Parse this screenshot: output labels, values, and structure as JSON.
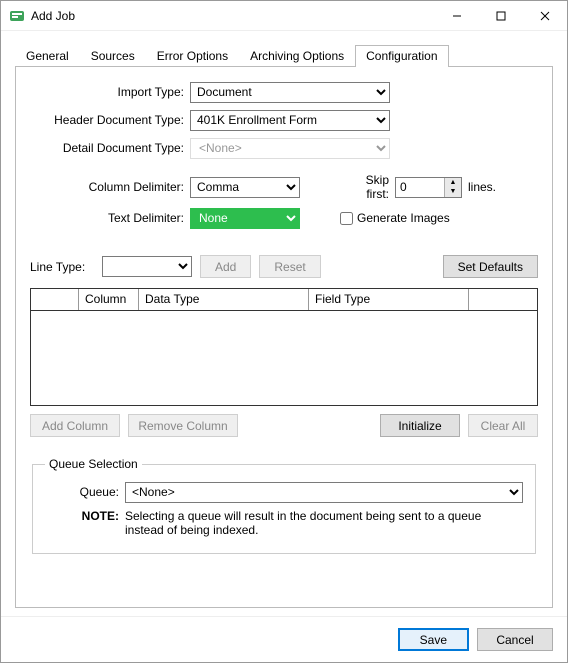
{
  "window": {
    "title": "Add Job"
  },
  "tabs": {
    "items": [
      {
        "label": "General"
      },
      {
        "label": "Sources"
      },
      {
        "label": "Error Options"
      },
      {
        "label": "Archiving Options"
      },
      {
        "label": "Configuration"
      }
    ],
    "active_index": 4
  },
  "config": {
    "import_type": {
      "label": "Import Type:",
      "value": "Document"
    },
    "header_doc_type": {
      "label": "Header Document Type:",
      "value": "401K Enrollment Form"
    },
    "detail_doc_type": {
      "label": "Detail Document Type:",
      "value": "<None>"
    },
    "column_delimiter": {
      "label": "Column Delimiter:",
      "value": "Comma"
    },
    "text_delimiter": {
      "label": "Text Delimiter:",
      "value": "None"
    },
    "skip_first": {
      "label": "Skip first:",
      "value": "0",
      "suffix": "lines."
    },
    "generate_images": {
      "label": "Generate Images",
      "checked": false
    },
    "line_type": {
      "label": "Line Type:",
      "value": ""
    },
    "buttons": {
      "add": "Add",
      "reset": "Reset",
      "set_defaults": "Set Defaults",
      "add_column": "Add Column",
      "remove_column": "Remove Column",
      "initialize": "Initialize",
      "clear_all": "Clear All"
    },
    "table": {
      "headers": {
        "col1": "",
        "col2": "Column",
        "col3": "Data Type",
        "col4": "Field Type",
        "col5": ""
      }
    },
    "queue": {
      "legend": "Queue Selection",
      "label": "Queue:",
      "value": "<None>",
      "note_label": "NOTE:",
      "note_text": "Selecting a queue will result in the document being sent to a queue instead of being indexed."
    }
  },
  "footer": {
    "save": "Save",
    "cancel": "Cancel"
  }
}
